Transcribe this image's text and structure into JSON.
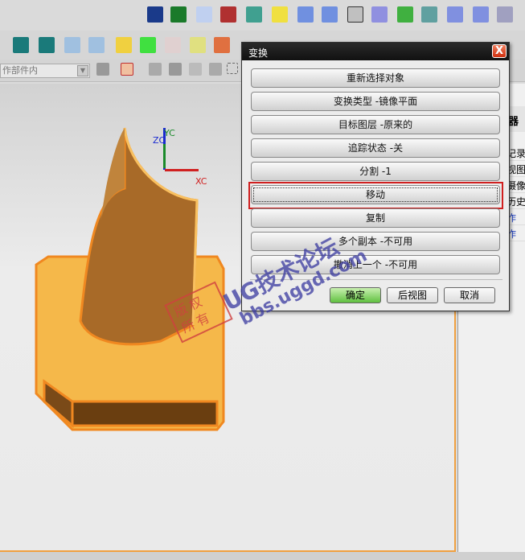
{
  "toolbar": {
    "filter_value": "作部件内"
  },
  "right_panel": {
    "header": "器",
    "rows": [
      "记录",
      "视图",
      "摄像",
      "历史",
      "作",
      "作"
    ]
  },
  "dialog": {
    "title": "变换",
    "close_label": "X",
    "menu": [
      "重新选择对象",
      "变换类型 -镜像平面",
      "目标图层 -原来的",
      "追踪状态 -关",
      "分割 -1",
      "移动",
      "复制",
      "多个副本 -不可用",
      "撤消上一个 -不可用"
    ],
    "ok": "确定",
    "back": "后视图",
    "cancel": "取消"
  },
  "axes": {
    "x": "XC",
    "y": "YC",
    "z": "ZC"
  },
  "watermark": {
    "line1": "UG技术论坛",
    "line2": "bbs.uggd.com",
    "stamp": "版权所有"
  }
}
